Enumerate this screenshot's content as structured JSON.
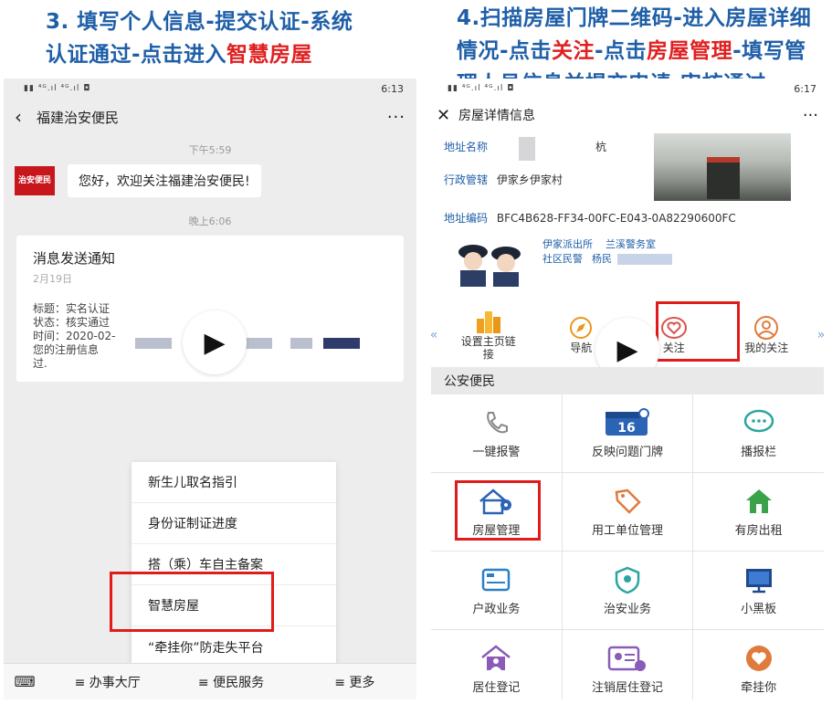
{
  "left_heading": {
    "line1": "3. 填写个人信息-提交认证-系统",
    "line2_a": "认证通过-点击进入",
    "line2_em": "智慧房屋"
  },
  "right_heading": {
    "line1": "4.扫描房屋门牌二维码-进入房屋详细",
    "line2_a": "情况-点击",
    "line2_em1": "关注",
    "line2_b": "-点击",
    "line2_em2": "房屋管理",
    "line2_c": "-填写管",
    "line3": "理人员信息并提交申请-审核通过"
  },
  "left_phone": {
    "status_time": "6:13",
    "chat_title": "福建治安便民",
    "timestamp1": "下午5:59",
    "avatar_text": "治安便民",
    "greeting": "您好，欢迎关注福建治安便民!",
    "timestamp2": "晚上6:06",
    "card": {
      "title": "消息发送通知",
      "date": "2月19日",
      "line1": "标题：实名认证",
      "line2": "状态：核实通过",
      "line3": "时间：2020-02-",
      "line4": "您的注册信息",
      "line5": "过."
    },
    "menu": [
      "新生儿取名指引",
      "身份证制证进度",
      "搭（乘）车自主备案",
      "智慧房屋",
      "“牵挂你”防走失平台"
    ],
    "bottom_tabs": [
      "≡ 办事大厅",
      "≡ 便民服务",
      "≡ 更多"
    ]
  },
  "right_phone": {
    "status_time": "6:17",
    "title": "房屋详情信息",
    "addr_name_label": "地址名称",
    "addr_name_val": "杭",
    "district_label": "行政管辖",
    "district_val": "伊家乡伊家村",
    "addr_code_label": "地址编码",
    "addr_code_val": "BFC4B628-FF34-00FC-E043-0A82290600FC",
    "station": "伊家派出所",
    "branch": "兰溪警务室",
    "officer": "社区民警",
    "officer_name": "杨民",
    "strip": [
      "设置主页链接",
      "导航",
      "关注",
      "我的关注"
    ],
    "section": "公安便民",
    "grid": [
      "一键报警",
      "反映问题门牌",
      "播报栏",
      "房屋管理",
      "用工单位管理",
      "有房出租",
      "户政业务",
      "治安业务",
      "小黑板",
      "居住登记",
      "注销居住登记",
      "牵挂你"
    ],
    "badge_number": "16"
  },
  "colors": {
    "accent_blue": "#1f5fa8",
    "highlight_red": "#e01b1b"
  }
}
